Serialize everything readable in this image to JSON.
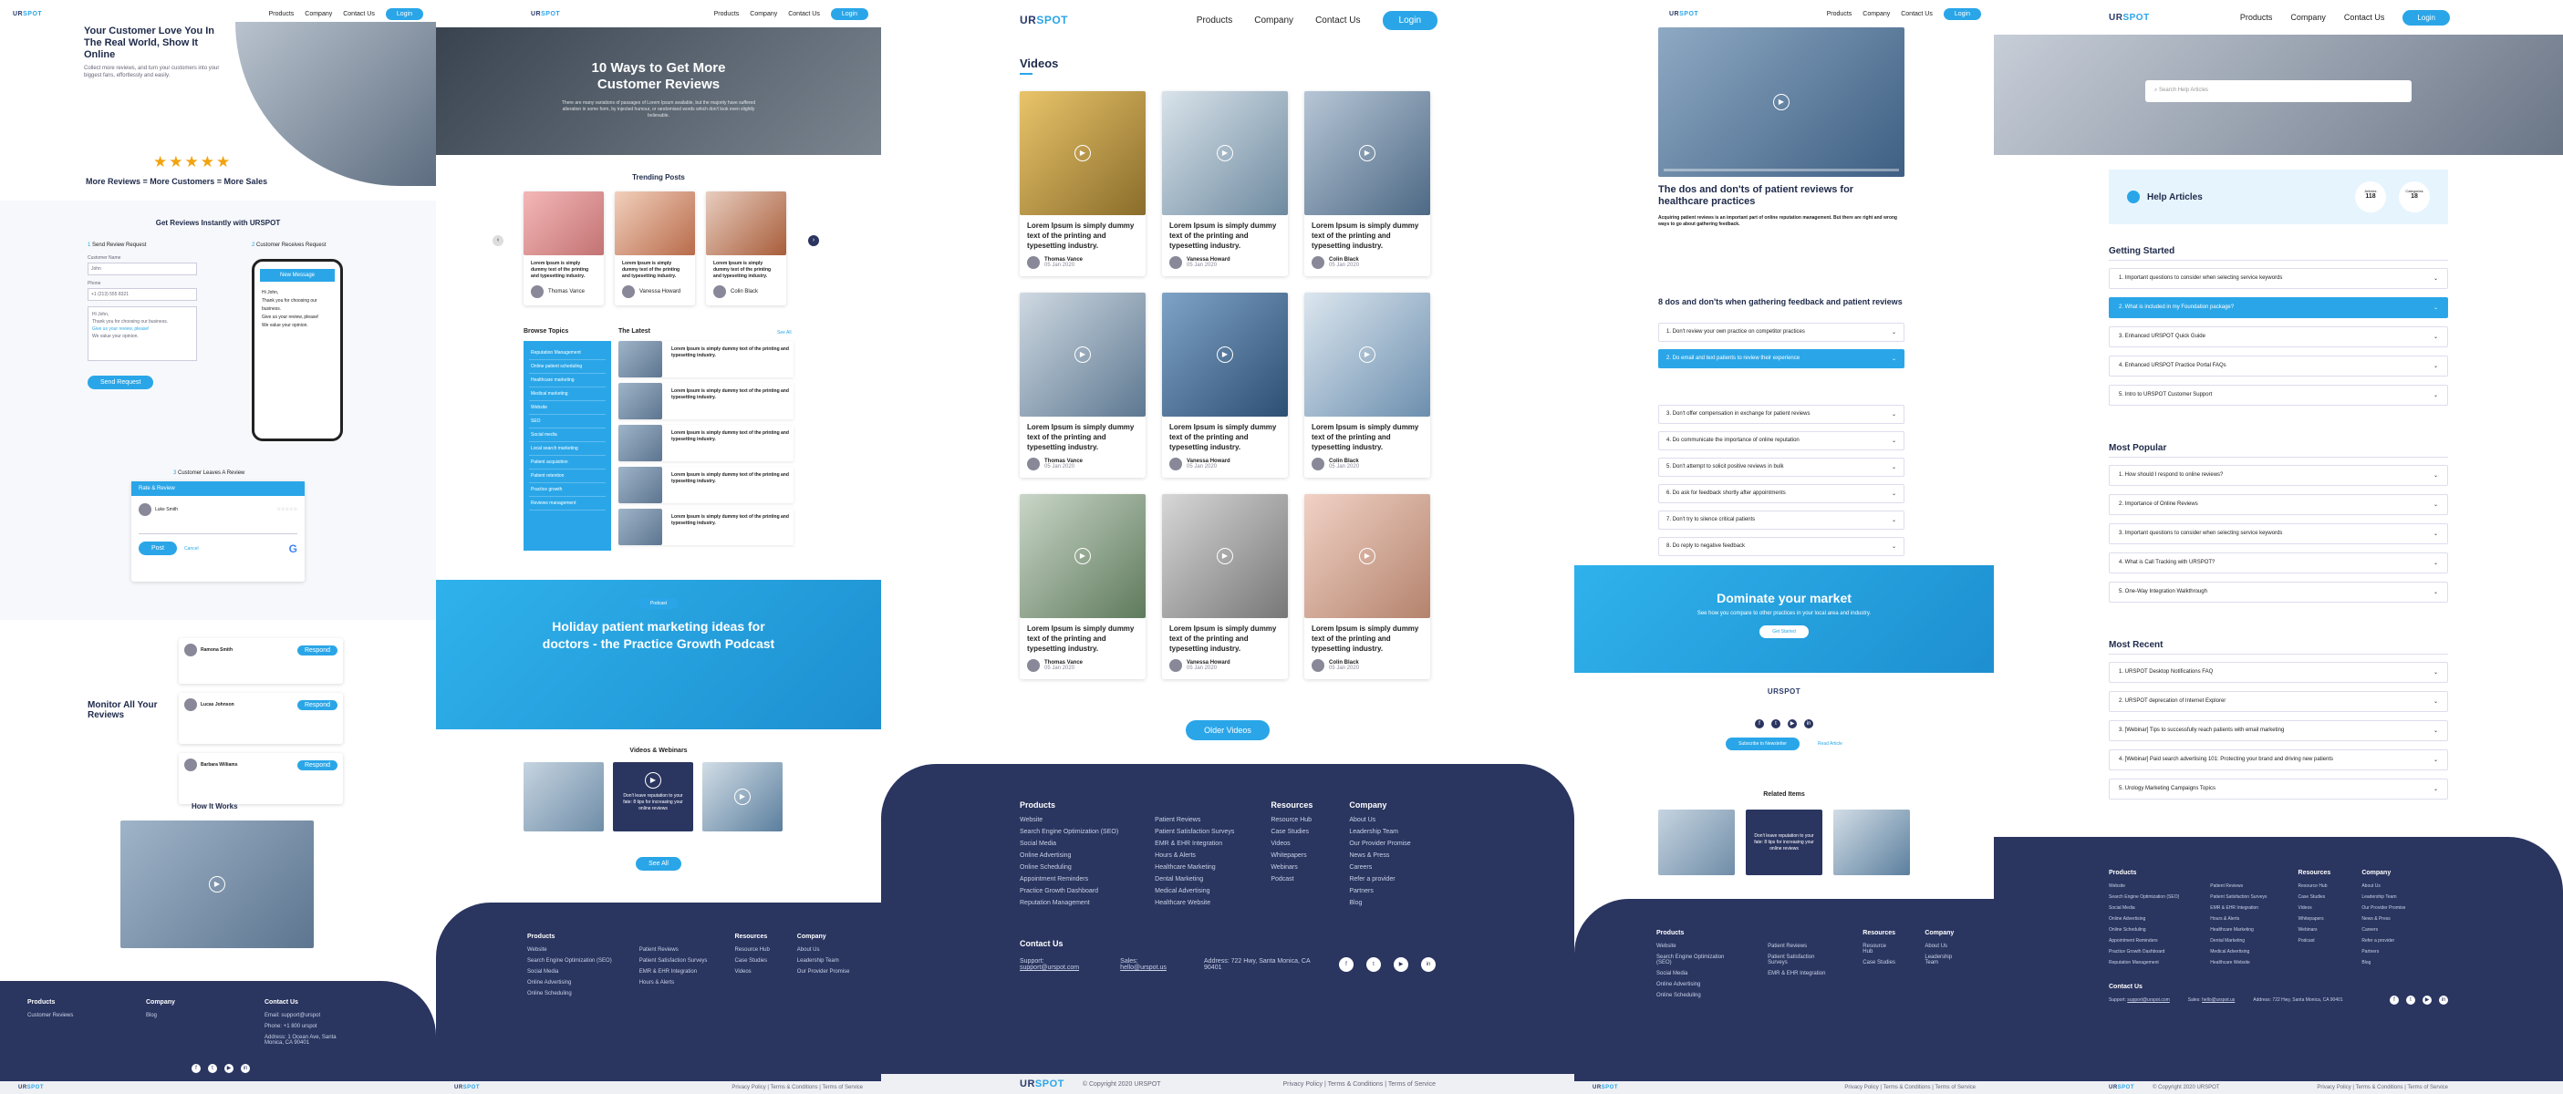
{
  "brand": {
    "logo_prefix": "UR",
    "logo_suffix": "SPOT",
    "accent": "#2aa6e8",
    "navy": "#2a3560"
  },
  "nav": {
    "products": "Products",
    "company": "Company",
    "contact": "Contact Us",
    "login": "Login"
  },
  "s1": {
    "hero_title": "Your Customer Love You In The Real World, Show It Online",
    "hero_sub": "Collect more reviews, and turn your customers into your biggest fans, effortlessly and easily.",
    "stars": "★★★★★",
    "tagline": "More Reviews = More Customers = More Sales",
    "section_title": "Get Reviews Instantly with URSPOT",
    "step1": "Send Review Request",
    "step2": "Customer Receives Request",
    "step3": "Customer Leaves A Review",
    "field_name_label": "Customer Name",
    "field_name_value": "John",
    "field_phone_label": "Phone",
    "field_phone_value": "+1 (213) 555 8321",
    "message_lines": [
      "Hi John,",
      "Thank you for choosing our business.",
      "Give us your review, please!",
      "We value your opinion."
    ],
    "send_btn": "Send Request",
    "phone_header": "New Message",
    "review_title": "Rate & Review",
    "review_name": "Luke Smith",
    "review_post": "Post",
    "review_cancel": "Cancel",
    "monitor_title": "Monitor All Your Reviews",
    "reviewers": [
      "Ramona Smith",
      "Lucas Johnson",
      "Barbara Williams"
    ],
    "reply_btn": "Respond",
    "how_title": "How It Works",
    "footer_products": "Products",
    "footer_company": "Company",
    "footer_contact": "Contact Us",
    "footer_items_products": [
      "Customer Reviews"
    ],
    "footer_items_company": [
      "Blog"
    ],
    "footer_items_contact": [
      "Email: support@urspot",
      "Phone: +1 800 urspot",
      "Address: 1 Ocean Ave, Santa Monica, CA 90401"
    ]
  },
  "s2": {
    "hero_title": "10 Ways to Get More Customer Reviews",
    "hero_sub": "There are many variations of passages of Lorem Ipsum available, but the majority have suffered alteration in some form, by injected humour, or randomised words which don't look even slightly believable.",
    "trending_title": "Trending Posts",
    "trending": [
      {
        "text": "Lorem Ipsum is simply dummy text of the printing and typesetting industry.",
        "author": "Thomas Vance"
      },
      {
        "text": "Lorem Ipsum is simply dummy text of the printing and typesetting industry.",
        "author": "Vanessa Howard"
      },
      {
        "text": "Lorem Ipsum is simply dummy text of the printing and typesetting industry.",
        "author": "Colin Black"
      }
    ],
    "browse_title": "Browse Topics",
    "topics": [
      "Reputation Management",
      "Online patient scheduling",
      "Healthcare marketing",
      "Medical marketing",
      "Website",
      "SEO",
      "Social media",
      "Local search marketing",
      "Patient acquisition",
      "Patient retention",
      "Practice growth",
      "Reviews management"
    ],
    "latest_title": "The Latest",
    "latest_more": "See All",
    "latest": [
      "Lorem Ipsum is simply dummy text of the printing and typesetting industry.",
      "Lorem Ipsum is simply dummy text of the printing and typesetting industry.",
      "Lorem Ipsum is simply dummy text of the printing and typesetting industry.",
      "Lorem Ipsum is simply dummy text of the printing and typesetting industry.",
      "Lorem Ipsum is simply dummy text of the printing and typesetting industry."
    ],
    "podcast_tag": "Podcast",
    "podcast_title": "Holiday patient marketing ideas for doctors - the Practice Growth Podcast",
    "videos_title": "Videos & Webinars",
    "video_mid_text": "Don't leave reputation to your fate: 8 tips for increasing your online reviews",
    "see_all": "See All"
  },
  "s3": {
    "section_title": "Videos",
    "videos": [
      {
        "text": "Lorem Ipsum is simply dummy text of the printing and typesetting industry.",
        "author": "Thomas Vance",
        "date": "05 Jan 2020"
      },
      {
        "text": "Lorem Ipsum is simply dummy text of the printing and typesetting industry.",
        "author": "Vanessa Howard",
        "date": "05 Jan 2020"
      },
      {
        "text": "Lorem Ipsum is simply dummy text of the printing and typesetting industry.",
        "author": "Colin Black",
        "date": "05 Jan 2020"
      },
      {
        "text": "Lorem Ipsum is simply dummy text of the printing and typesetting industry.",
        "author": "Thomas Vance",
        "date": "05 Jan 2020"
      },
      {
        "text": "Lorem Ipsum is simply dummy text of the printing and typesetting industry.",
        "author": "Vanessa Howard",
        "date": "05 Jan 2020"
      },
      {
        "text": "Lorem Ipsum is simply dummy text of the printing and typesetting industry.",
        "author": "Colin Black",
        "date": "05 Jan 2020"
      },
      {
        "text": "Lorem Ipsum is simply dummy text of the printing and typesetting industry.",
        "author": "Thomas Vance",
        "date": "05 Jan 2020"
      },
      {
        "text": "Lorem Ipsum is simply dummy text of the printing and typesetting industry.",
        "author": "Vanessa Howard",
        "date": "05 Jan 2020"
      },
      {
        "text": "Lorem Ipsum is simply dummy text of the printing and typesetting industry.",
        "author": "Colin Black",
        "date": "05 Jan 2020"
      }
    ],
    "older_btn": "Older Videos",
    "footer": {
      "products_title": "Products",
      "products_a": [
        "Website",
        "Search Engine Optimization (SEO)",
        "Social Media",
        "Online Advertising",
        "Online Scheduling",
        "Appointment Reminders",
        "Practice Growth Dashboard",
        "Reputation Management"
      ],
      "products_b": [
        "Patient Reviews",
        "Patient Satisfaction Surveys",
        "EMR & EHR Integration",
        "Hours & Alerts",
        "Healthcare Marketing",
        "Dental Marketing",
        "Medical Advertising",
        "Healthcare Website"
      ],
      "resources_title": "Resources",
      "resources": [
        "Resource Hub",
        "Case Studies",
        "Videos",
        "Whitepapers",
        "Webinars",
        "Podcast"
      ],
      "company_title": "Company",
      "company": [
        "About Us",
        "Leadership Team",
        "Our Provider Promise",
        "News & Press",
        "Careers",
        "Refer a provider",
        "Partners",
        "Blog"
      ],
      "contact_title": "Contact Us",
      "support_label": "Support:",
      "support_value": "support@urspot.com",
      "sales_label": "Sales:",
      "sales_value": "hello@urspot.us",
      "address_label": "Address:",
      "address_value": "722 Hwy, Santa Monica, CA 90401",
      "copyright": "© Copyright 2020 URSPOT",
      "legal": "Privacy Policy  |  Terms & Conditions  |  Terms of Service"
    }
  },
  "s4": {
    "article_title": "The dos and don'ts of patient reviews for healthcare practices",
    "article_lead": "Acquiring patient reviews is an important part of online reputation management. But there are right and wrong ways to go about gathering feedback.",
    "section_title": "8 dos and don'ts when gathering feedback and patient reviews",
    "items": [
      "1. Don't review your own practice on competitor practices",
      "2. Do email and text patients to review their experience",
      "3. Don't offer compensation in exchange for patient reviews",
      "4. Do communicate the importance of online reputation",
      "5. Don't attempt to solicit positive reviews in bulk",
      "6. Do ask for feedback shortly after appointments",
      "7. Don't try to silence critical patients",
      "8. Do reply to negative feedback"
    ],
    "cta_title": "Dominate your market",
    "cta_sub": "See how you compare to other practices in your local area and industry.",
    "cta_btn": "Get Started",
    "author_logo": "URSPOT",
    "related_title": "Related Items",
    "related_mid": "Don't leave reputation to your fate: 8 tips for increasing your online reviews",
    "subscribe_btn": "Subscribe to Newsletter",
    "other_btn": "Read Article"
  },
  "s5": {
    "search_placeholder": "Search Help Articles",
    "help_title": "Help Articles",
    "stat1_label": "Articles",
    "stat1_value": "118",
    "stat2_label": "Categories",
    "stat2_value": "18",
    "getting_started_title": "Getting Started",
    "getting_started": [
      "1. Important questions to consider when selecting service keywords",
      "2. What is included in my Foundation package?",
      "3. Enhanced URSPOT Quick Guide",
      "4. Enhanced URSPOT Practice Portal FAQs",
      "5. Intro to URSPOT Customer Support"
    ],
    "popular_title": "Most Popular",
    "popular": [
      "1. How should I respond to online reviews?",
      "2. Importance of Online Reviews",
      "3. Important questions to consider when selecting service keywords",
      "4. What is Call Tracking with URSPOT?",
      "5. One-Way Integration Walkthrough"
    ],
    "recent_title": "Most Recent",
    "recent": [
      "1. URSPOT Desktop Notifications FAQ",
      "2. URSPOT deprecation of Internet Explorer",
      "3. [Webinar] Tips to successfully reach patients with email marketing",
      "4. [Webinar] Paid search advertising 101: Protecting your brand and driving new patients",
      "5. Urology Marketing Campaigns Topics"
    ]
  }
}
